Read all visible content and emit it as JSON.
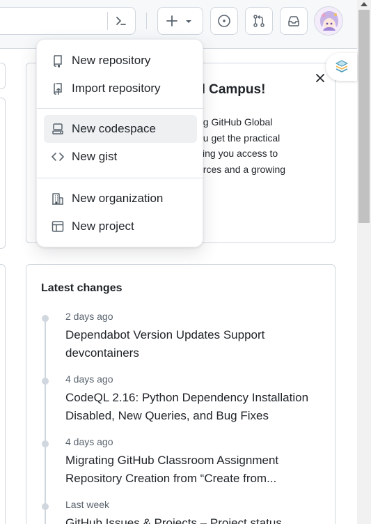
{
  "header": {
    "command_icon": "command-palette-icon",
    "create_menu_icon": "plus-icon",
    "issues_icon": "issue-opened-icon",
    "pulls_icon": "git-pull-request-icon",
    "inbox_icon": "inbox-icon",
    "avatar_icon": "user-avatar"
  },
  "create_menu": {
    "groups": [
      [
        {
          "label": "New repository",
          "icon": "repo-icon"
        },
        {
          "label": "Import repository",
          "icon": "repo-push-icon"
        }
      ],
      [
        {
          "label": "New codespace",
          "icon": "codespaces-icon"
        },
        {
          "label": "New gist",
          "icon": "code-icon"
        }
      ],
      [
        {
          "label": "New organization",
          "icon": "organization-icon"
        },
        {
          "label": "New project",
          "icon": "table-icon"
        }
      ]
    ]
  },
  "campus_card": {
    "title_fragment": "al Campus!",
    "lines": [
      "ng GitHub Global",
      "ou get the practical",
      "ving you access to",
      "urces and a growing"
    ]
  },
  "latest_changes": {
    "title": "Latest changes",
    "items": [
      {
        "date": "2 days ago",
        "title": "Dependabot Version Updates Support devcontainers"
      },
      {
        "date": "4 days ago",
        "title": "CodeQL 2.16: Python Dependency Installation Disabled, New Queries, and Bug Fixes"
      },
      {
        "date": "4 days ago",
        "title": "Migrating GitHub Classroom Assignment Repository Creation from “Create from..."
      },
      {
        "date": "Last week",
        "title": "GitHub Issues & Projects – Project status"
      }
    ]
  },
  "colors": {
    "border": "#d0d7de",
    "text": "#1f2328",
    "muted": "#59636e",
    "hover": "#eef0f2"
  }
}
